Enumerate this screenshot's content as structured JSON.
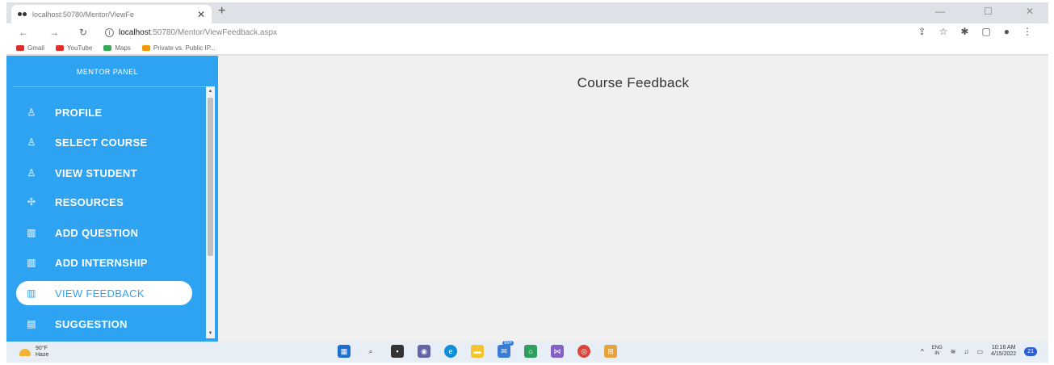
{
  "browser": {
    "tab_title": "localhost:50780/Mentor/ViewFe",
    "tab_close": "✕",
    "new_tab": "+",
    "url_host": "localhost",
    "url_path": ":50780/Mentor/ViewFeedback.aspx",
    "win_min": "—",
    "win_max": "☐",
    "win_close": "✕"
  },
  "bookmarks": [
    {
      "label": "Gmail",
      "icon": "gmail-icon",
      "color": "#d93025"
    },
    {
      "label": "YouTube",
      "icon": "youtube-icon",
      "color": "#e52d27"
    },
    {
      "label": "Maps",
      "icon": "maps-icon",
      "color": "#34a853"
    },
    {
      "label": "Private vs. Public IP...",
      "icon": "bookmark-icon",
      "color": "#f29900"
    }
  ],
  "sidebar": {
    "title": "MENTOR PANEL",
    "items": [
      {
        "label": "PROFILE",
        "icon": "user-icon",
        "glyph": "♙"
      },
      {
        "label": "SELECT COURSE",
        "icon": "user-icon",
        "glyph": "♙"
      },
      {
        "label": "VIEW STUDENT",
        "icon": "user-icon",
        "glyph": "♙"
      },
      {
        "label": "RESOURCES",
        "icon": "atom-icon",
        "glyph": "✣"
      },
      {
        "label": "ADD QUESTION",
        "icon": "map-icon",
        "glyph": "▥"
      },
      {
        "label": "ADD INTERNSHIP",
        "icon": "map-icon",
        "glyph": "▥"
      },
      {
        "label": "VIEW FEEDBACK",
        "icon": "map-icon",
        "glyph": "▥"
      },
      {
        "label": "SUGGESTION",
        "icon": "note-icon",
        "glyph": "▤"
      }
    ],
    "active_index": 6
  },
  "main": {
    "title": "Course Feedback"
  },
  "taskbar": {
    "weather_temp": "90°F",
    "weather_desc": "Haze",
    "lang_top": "ENG",
    "lang_bottom": "IN",
    "time": "10:16 AM",
    "date": "4/15/2022",
    "notification_count": "21",
    "badge": "99+"
  },
  "colors": {
    "sidebar_bg": "#2ea3f2",
    "accent": "#2ea3f2",
    "page_bg": "#f0f0f0"
  }
}
